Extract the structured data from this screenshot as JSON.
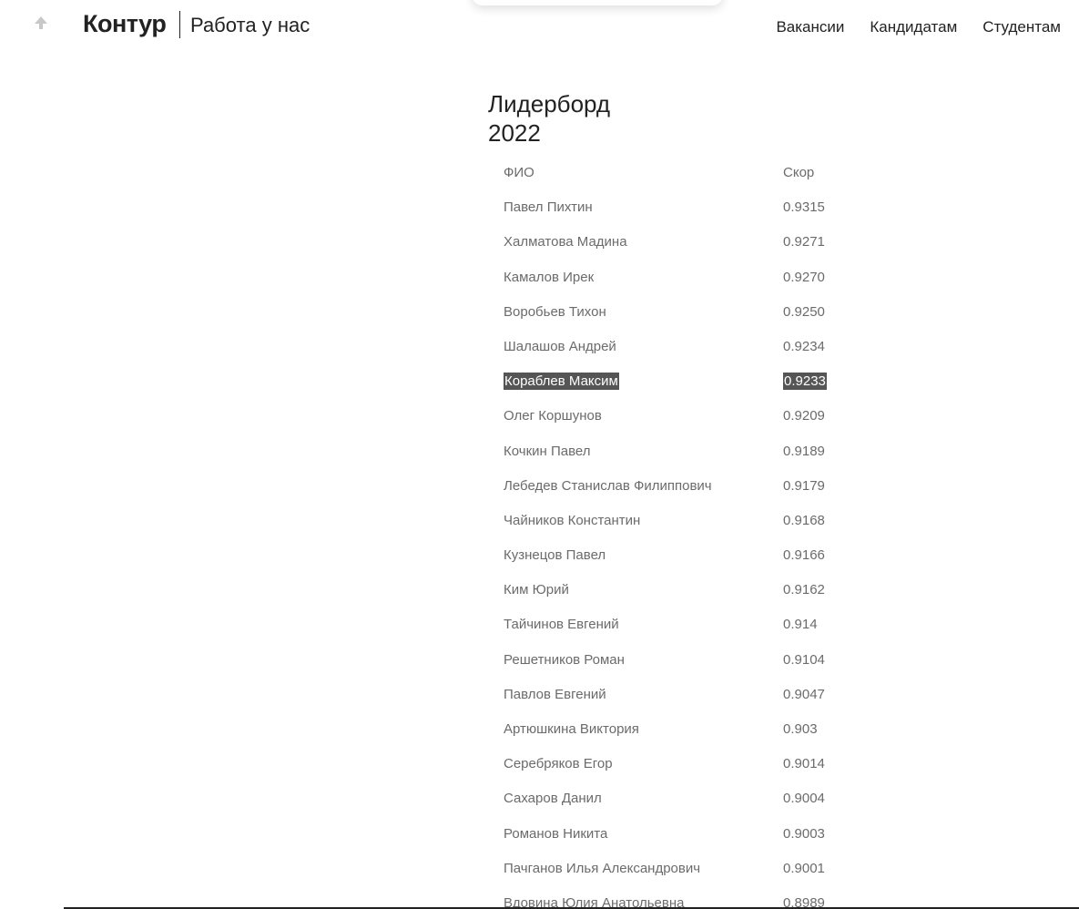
{
  "header": {
    "logo": "Контур",
    "section": "Работа у нас",
    "nav": [
      "Вакансии",
      "Кандидатам",
      "Студентам"
    ]
  },
  "leaderboard": {
    "title_line1": "Лидерборд",
    "title_line2": "2022",
    "columns": {
      "name": "ФИО",
      "score": "Скор"
    },
    "rows": [
      {
        "name": "Павел Пихтин",
        "score": "0.9315"
      },
      {
        "name": "Халматова Мадина",
        "score": "0.9271"
      },
      {
        "name": "Камалов Ирек",
        "score": "0.9270"
      },
      {
        "name": "Воробьев Тихон",
        "score": "0.9250"
      },
      {
        "name": "Шалашов Андрей",
        "score": "0.9234"
      },
      {
        "name": "Кораблев Максим",
        "score": "0.9233",
        "selected": true
      },
      {
        "name": "Олег Коршунов",
        "score": "0.9209"
      },
      {
        "name": "Кочкин Павел",
        "score": "0.9189"
      },
      {
        "name": "Лебедев Станислав Филиппович",
        "score": "0.9179"
      },
      {
        "name": "Чайников Константин",
        "score": "0.9168"
      },
      {
        "name": "Кузнецов Павел",
        "score": "0.9166"
      },
      {
        "name": "Ким Юрий",
        "score": "0.9162"
      },
      {
        "name": "Тайчинов Евгений",
        "score": "0.914"
      },
      {
        "name": "Решетников Роман",
        "score": "0.9104"
      },
      {
        "name": "Павлов Евгений",
        "score": "0.9047"
      },
      {
        "name": "Артюшкина Виктория",
        "score": "0.903"
      },
      {
        "name": "Серебряков Егор",
        "score": "0.9014"
      },
      {
        "name": "Сахаров Данил",
        "score": "0.9004"
      },
      {
        "name": "Романов Никита",
        "score": "0.9003"
      },
      {
        "name": "Пачганов Илья Александрович",
        "score": "0.9001"
      },
      {
        "name": "Вдовина Юлия Анатольевна",
        "score": "0.8989"
      }
    ]
  },
  "icons": {
    "scroll_top": "arrow-up-icon"
  }
}
